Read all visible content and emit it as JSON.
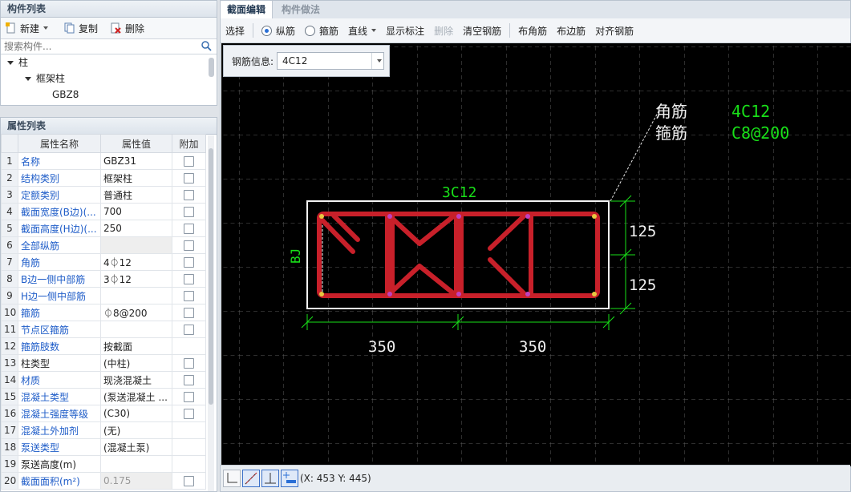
{
  "component_panel": {
    "title": "构件列表",
    "toolbar": {
      "new_label": "新建",
      "copy_label": "复制",
      "delete_label": "删除"
    },
    "search_placeholder": "搜索构件...",
    "tree": {
      "root": "柱",
      "child": "框架柱",
      "leaf": "GBZ8"
    }
  },
  "property_panel": {
    "title": "属性列表",
    "headers": {
      "name": "属性名称",
      "value": "属性值",
      "extra": "附加"
    },
    "rows": [
      {
        "n": "1",
        "name": "名称",
        "value": "GBZ31"
      },
      {
        "n": "2",
        "name": "结构类别",
        "value": "框架柱"
      },
      {
        "n": "3",
        "name": "定额类别",
        "value": "普通柱"
      },
      {
        "n": "4",
        "name": "截面宽度(B边)(...",
        "value": "700"
      },
      {
        "n": "5",
        "name": "截面高度(H边)(...",
        "value": "250"
      },
      {
        "n": "6",
        "name": "全部纵筋",
        "value": ""
      },
      {
        "n": "7",
        "name": "角筋",
        "value": "4⏀12"
      },
      {
        "n": "8",
        "name": "B边一侧中部筋",
        "value": "3⏀12"
      },
      {
        "n": "9",
        "name": "H边一侧中部筋",
        "value": ""
      },
      {
        "n": "10",
        "name": "箍筋",
        "value": "⏀8@200"
      },
      {
        "n": "11",
        "name": "节点区箍筋",
        "value": ""
      },
      {
        "n": "12",
        "name": "箍筋肢数",
        "value": "按截面"
      },
      {
        "n": "13",
        "name": "柱类型",
        "value": "(中柱)"
      },
      {
        "n": "14",
        "name": "材质",
        "value": "现浇混凝土"
      },
      {
        "n": "15",
        "name": "混凝土类型",
        "value": "(泵送混凝土 ..."
      },
      {
        "n": "16",
        "name": "混凝土强度等级",
        "value": "(C30)"
      },
      {
        "n": "17",
        "name": "混凝土外加剂",
        "value": "(无)"
      },
      {
        "n": "18",
        "name": "泵送类型",
        "value": "(混凝土泵)"
      },
      {
        "n": "19",
        "name": "泵送高度(m)",
        "value": ""
      },
      {
        "n": "20",
        "name": "截面面积(m²)",
        "value": "0.175"
      }
    ]
  },
  "editor": {
    "tabs": {
      "active": "截面编辑",
      "inactive": "构件做法"
    },
    "toolbar": {
      "select": "选择",
      "longitudinal": "纵筋",
      "stirrup": "箍筋",
      "line": "直线",
      "show_label": "显示标注",
      "delete": "删除",
      "clear": "清空钢筋",
      "corner": "布角筋",
      "edge": "布边筋",
      "align": "对齐钢筋"
    },
    "rebar_info_label": "钢筋信息:",
    "rebar_info_value": "4C12",
    "canvas": {
      "corner_label": "角筋",
      "corner_value": "4C12",
      "stirrup_label": "箍筋",
      "stirrup_value": "C8@200",
      "top_rebar": "3C12",
      "side_label": "BJ",
      "dim_h1": "125",
      "dim_h2": "125",
      "dim_w1": "350",
      "dim_w2": "350"
    },
    "coords": "(X: 453 Y: 445)"
  }
}
